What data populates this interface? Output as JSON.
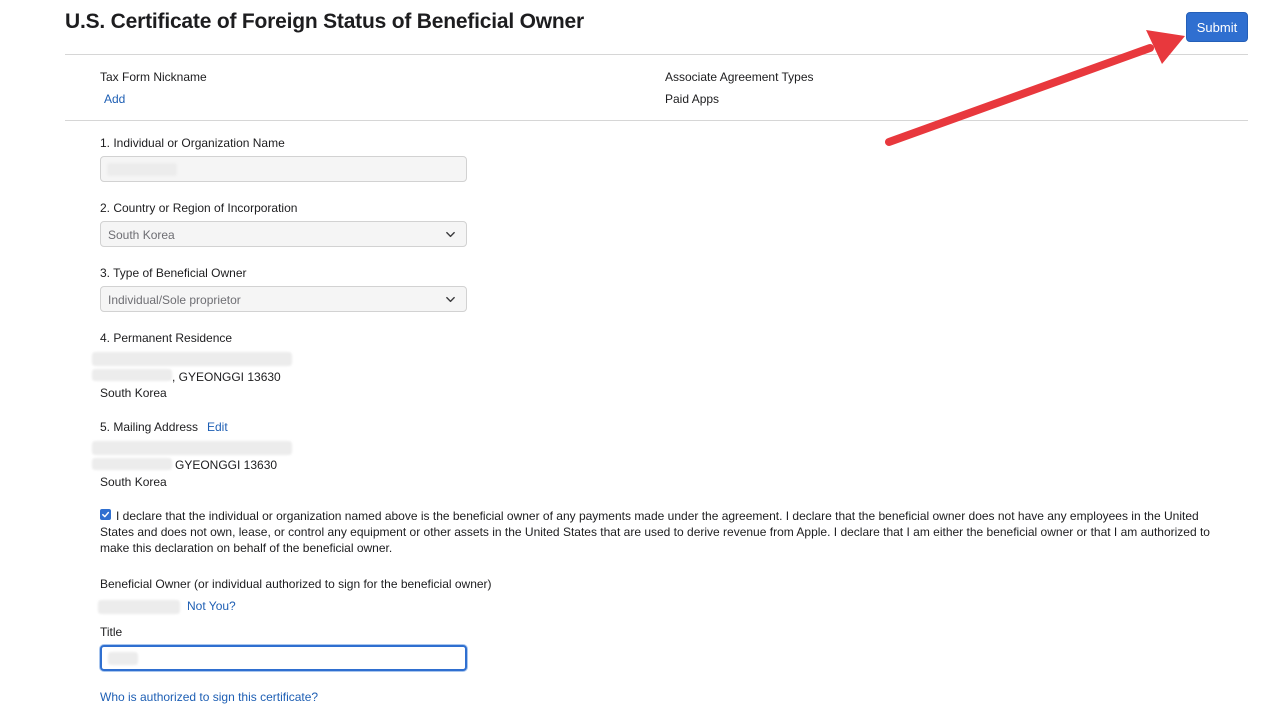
{
  "header": {
    "title": "U.S. Certificate of Foreign Status of Beneficial Owner",
    "submit_label": "Submit"
  },
  "summary": {
    "nickname_label": "Tax Form Nickname",
    "nickname_add": "Add",
    "agreement_label": "Associate Agreement Types",
    "agreement_value": "Paid Apps"
  },
  "form": {
    "name_label": "1. Individual or Organization Name",
    "country_label": "2. Country or Region of Incorporation",
    "country_value": "South Korea",
    "type_label": "3. Type of Beneficial Owner",
    "type_value": "Individual/Sole proprietor",
    "residence_label": "4. Permanent Residence",
    "residence_line2": ", GYEONGGI 13630",
    "residence_line3": "South Korea",
    "mailing_label": "5. Mailing Address",
    "mailing_edit": "Edit",
    "mailing_line2": "GYEONGGI 13630",
    "mailing_line3": "South Korea",
    "declaration": "I declare that the individual or organization named above is the beneficial owner of any payments made under the agreement. I declare that the beneficial owner does not have any employees in the United States and does not own, lease, or control any equipment or other assets in the United States that are used to derive revenue from Apple. I declare that I am either the beneficial owner or that I am authorized to make this declaration on behalf of the beneficial owner.",
    "declaration_checked": true,
    "owner_label": "Beneficial Owner (or individual authorized to sign for the beneficial owner)",
    "not_you": "Not You?",
    "title_label": "Title",
    "who_link": "Who is authorized to sign this certificate?"
  },
  "colors": {
    "accent": "#2f6fd0",
    "link": "#1e5fb4",
    "annotation_arrow": "#e8383d"
  },
  "icons": [
    "chevron-down-icon",
    "checkmark-icon",
    "annotation-arrow"
  ]
}
